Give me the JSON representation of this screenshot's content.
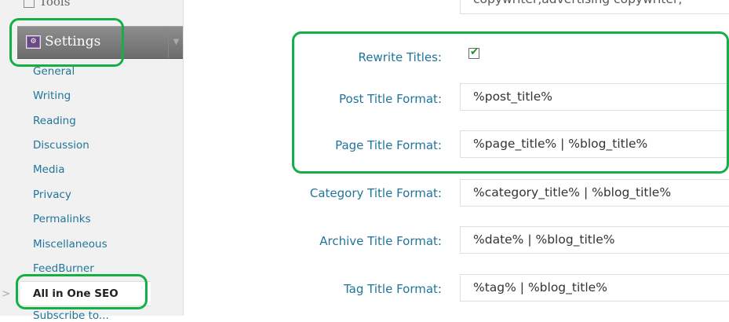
{
  "sidebar": {
    "tools_label": "Tools",
    "settings_label": "Settings",
    "settings_icon": "settings-icon",
    "items": [
      {
        "label": "General"
      },
      {
        "label": "Writing"
      },
      {
        "label": "Reading"
      },
      {
        "label": "Discussion"
      },
      {
        "label": "Media"
      },
      {
        "label": "Privacy"
      },
      {
        "label": "Permalinks"
      },
      {
        "label": "Miscellaneous"
      },
      {
        "label": "FeedBurner"
      },
      {
        "label": "All in One SEO"
      },
      {
        "label": "Subscribe to..."
      }
    ]
  },
  "form": {
    "top_field_value": "copywriter,advertising copywriter,",
    "rewrite_titles_label": "Rewrite Titles:",
    "rewrite_titles_checked": true,
    "rows": [
      {
        "label": "Post Title Format:",
        "value": "%post_title%"
      },
      {
        "label": "Page Title Format:",
        "value": "%page_title% | %blog_title%"
      },
      {
        "label": "Category Title Format:",
        "value": "%category_title% | %blog_title%"
      },
      {
        "label": "Archive Title Format:",
        "value": "%date% | %blog_title%"
      },
      {
        "label": "Tag Title Format:",
        "value": "%tag% | %blog_title%"
      }
    ]
  },
  "colors": {
    "highlight": "#14b046",
    "link": "#21759b",
    "settings_bar": "#7b7b7b"
  }
}
